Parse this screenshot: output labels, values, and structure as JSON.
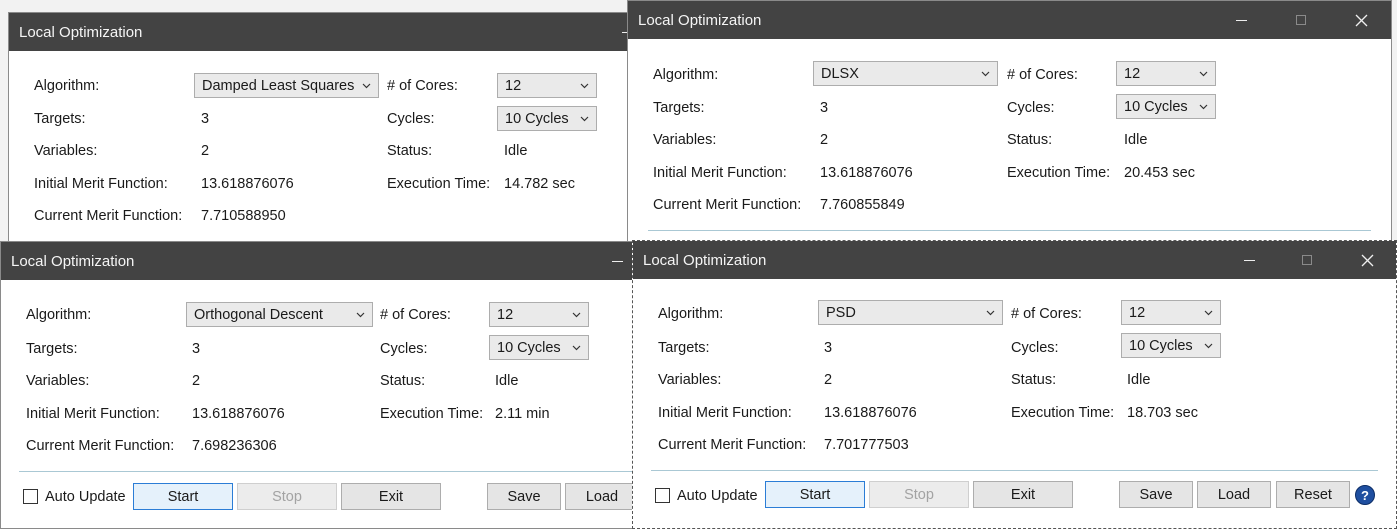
{
  "labels": {
    "algorithm": "Algorithm:",
    "targets": "Targets:",
    "variables": "Variables:",
    "initial_merit": "Initial Merit Function:",
    "current_merit": "Current Merit Function:",
    "cores": "# of Cores:",
    "cycles": "Cycles:",
    "status": "Status:",
    "exec_time": "Execution Time:"
  },
  "buttons": {
    "auto_update": "Auto Update",
    "start": "Start",
    "stop": "Stop",
    "exit": "Exit",
    "save": "Save",
    "load": "Load",
    "reset": "Reset",
    "help": "?"
  },
  "windows": [
    {
      "title": "Local Optimization",
      "algorithm": "Damped Least Squares",
      "cores": "12",
      "cycles": "10 Cycles",
      "targets": "3",
      "variables": "2",
      "status": "Idle",
      "initial_merit": "13.618876076",
      "current_merit": "7.710588950",
      "exec_time": "14.782 sec"
    },
    {
      "title": "Local Optimization",
      "algorithm": "DLSX",
      "cores": "12",
      "cycles": "10 Cycles",
      "targets": "3",
      "variables": "2",
      "status": "Idle",
      "initial_merit": "13.618876076",
      "current_merit": "7.760855849",
      "exec_time": "20.453 sec"
    },
    {
      "title": "Local Optimization",
      "algorithm": "Orthogonal Descent",
      "cores": "12",
      "cycles": "10 Cycles",
      "targets": "3",
      "variables": "2",
      "status": "Idle",
      "initial_merit": "13.618876076",
      "current_merit": "7.698236306",
      "exec_time": "2.11 min"
    },
    {
      "title": "Local Optimization",
      "algorithm": "PSD",
      "cores": "12",
      "cycles": "10 Cycles",
      "targets": "3",
      "variables": "2",
      "status": "Idle",
      "initial_merit": "13.618876076",
      "current_merit": "7.701777503",
      "exec_time": "18.703 sec"
    }
  ]
}
